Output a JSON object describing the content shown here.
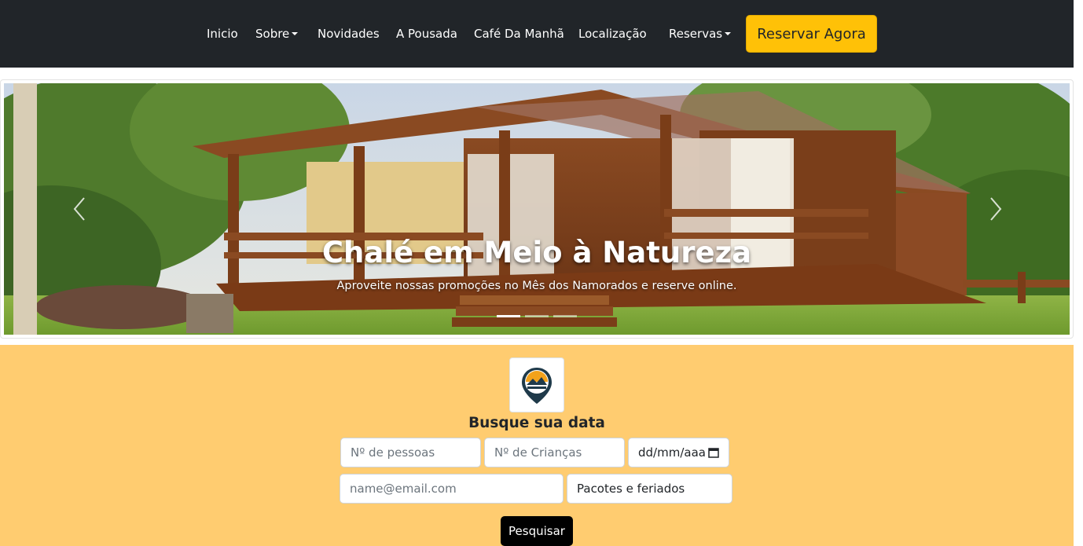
{
  "nav": {
    "items": [
      {
        "label": "Inicio",
        "has_caret": false
      },
      {
        "label": "Sobre",
        "has_caret": true
      },
      {
        "label": "Novidades",
        "has_caret": false
      },
      {
        "label": "A Pousada",
        "has_caret": false
      },
      {
        "label": "Café Da Manhã",
        "has_caret": false
      },
      {
        "label": "Localização",
        "has_caret": false
      },
      {
        "label": "Reservas",
        "has_caret": true
      }
    ],
    "cta_label": "Reservar Agora",
    "bg_color": "#212529",
    "cta_color": "#ffc107"
  },
  "carousel": {
    "caption_title": "Chalé em Meio à Natureza",
    "caption_text": "Aproveite nossas promoções no Mês dos Namorados e reserve online.",
    "prev_icon": "chevron-left-icon",
    "next_icon": "chevron-right-icon",
    "slide_count": 3,
    "active_slide": 1
  },
  "search": {
    "title": "Busque sua data",
    "people_placeholder": "Nº de pessoas",
    "children_placeholder": "Nº de Crianças",
    "date_placeholder": "dd/mm/aaaa",
    "email_placeholder": "name@email.com",
    "package_value": "Pacotes e feriados",
    "button_label": "Pesquisar",
    "bg_color": "#ffcc70",
    "logo_icon": "location-pin-logo-icon"
  }
}
